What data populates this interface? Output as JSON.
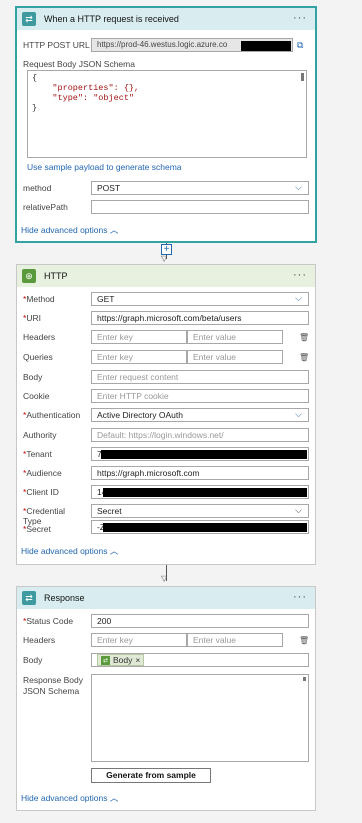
{
  "trigger": {
    "title": "When a HTTP request is received",
    "url_label": "HTTP POST URL",
    "url_value": "https://prod-46.westus.logic.azure.co",
    "schema_label": "Request Body JSON Schema",
    "schema_lines": [
      "{",
      "    \"properties\": {},",
      "    \"type\": \"object\"",
      "}"
    ],
    "sample_link": "Use sample payload to generate schema",
    "method_label": "method",
    "method_value": "POST",
    "relpath_label": "relativePath",
    "relpath_value": "",
    "hide_link": "Hide advanced options"
  },
  "connector_plus": "+",
  "http": {
    "title": "HTTP",
    "method_label": "Method",
    "method_value": "GET",
    "uri_label": "URI",
    "uri_value": "https://graph.microsoft.com/beta/users",
    "headers_label": "Headers",
    "queries_label": "Queries",
    "key_placeholder": "Enter key",
    "value_placeholder": "Enter value",
    "body_label": "Body",
    "body_placeholder": "Enter request content",
    "cookie_label": "Cookie",
    "cookie_placeholder": "Enter HTTP cookie",
    "auth_label": "Authentication",
    "auth_value": "Active Directory OAuth",
    "authority_label": "Authority",
    "authority_placeholder": "Default: https://login.windows.net/",
    "tenant_label": "Tenant",
    "tenant_value": "7c",
    "audience_label": "Audience",
    "audience_value": "https://graph.microsoft.com",
    "clientid_label": "Client ID",
    "clientid_value": "14",
    "credtype_label": "Credential Type",
    "credtype_value": "Secret",
    "secret_label": "Secret",
    "secret_value": "-Z",
    "hide_link": "Hide advanced options"
  },
  "response": {
    "title": "Response",
    "status_label": "Status Code",
    "status_value": "200",
    "headers_label": "Headers",
    "key_placeholder": "Enter key",
    "value_placeholder": "Enter value",
    "body_label": "Body",
    "body_token": "Body",
    "schema_label": "Response Body JSON Schema",
    "generate_button": "Generate from sample",
    "hide_link": "Hide advanced options"
  },
  "icons": {
    "trigger": "http-request-icon",
    "action": "http-action-icon",
    "more": "ellipsis-icon",
    "copy": "copy-icon",
    "delete": "trash-icon",
    "dropdown": "chevron-down-icon",
    "collapse": "chevron-up-icon"
  },
  "colors": {
    "trigger_header": "#d9edf0",
    "action_header": "#e8f1e0",
    "selected_border": "#31a3a3",
    "link": "#2266b0",
    "required": "#cc0000"
  }
}
